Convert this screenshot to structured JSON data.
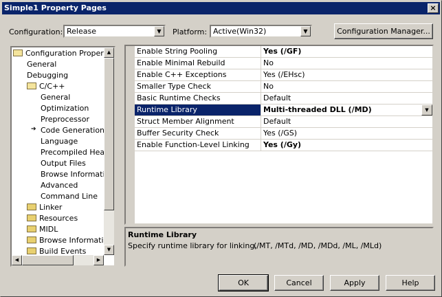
{
  "window": {
    "title": "Simple1 Property Pages",
    "close": "×"
  },
  "config": {
    "configuration_label": "Configuration:",
    "configuration_value": "Release",
    "platform_label": "Platform:",
    "platform_value": "Active(Win32)",
    "manager_button": "Configuration Manager..."
  },
  "tree": [
    {
      "label": "Configuration Properties",
      "folder": "open"
    },
    {
      "label": "General"
    },
    {
      "label": "Debugging"
    },
    {
      "label": "C/C++",
      "folder": "open"
    },
    {
      "label": "General"
    },
    {
      "label": "Optimization"
    },
    {
      "label": "Preprocessor"
    },
    {
      "label": "Code Generation",
      "current": true
    },
    {
      "label": "Language"
    },
    {
      "label": "Precompiled Headers"
    },
    {
      "label": "Output Files"
    },
    {
      "label": "Browse Information"
    },
    {
      "label": "Advanced"
    },
    {
      "label": "Command Line"
    },
    {
      "label": "Linker",
      "folder": "closed"
    },
    {
      "label": "Resources",
      "folder": "closed"
    },
    {
      "label": "MIDL",
      "folder": "closed"
    },
    {
      "label": "Browse Information",
      "folder": "closed"
    },
    {
      "label": "Build Events",
      "folder": "closed"
    }
  ],
  "properties": [
    {
      "name": "Enable String Pooling",
      "value": "Yes (/GF)",
      "bold": true
    },
    {
      "name": "Enable Minimal Rebuild",
      "value": "No"
    },
    {
      "name": "Enable C++ Exceptions",
      "value": "Yes (/EHsc)"
    },
    {
      "name": "Smaller Type Check",
      "value": "No"
    },
    {
      "name": "Basic Runtime Checks",
      "value": "Default"
    },
    {
      "name": "Runtime Library",
      "value": "Multi-threaded DLL (/MD)",
      "bold": true,
      "selected": true
    },
    {
      "name": "Struct Member Alignment",
      "value": "Default"
    },
    {
      "name": "Buffer Security Check",
      "value": "Yes (/GS)"
    },
    {
      "name": "Enable Function-Level Linking",
      "value": "Yes (/Gy)",
      "bold": true
    }
  ],
  "description": {
    "title": "Runtime Library",
    "text": "Specify runtime library for linking.",
    "options": "(/MT, /MTd, /MD, /MDd, /ML, /MLd)"
  },
  "buttons": {
    "ok": "OK",
    "cancel": "Cancel",
    "apply": "Apply",
    "help": "Help"
  },
  "colors": {
    "selection": "#0a246a",
    "face": "#d4d0c8"
  }
}
